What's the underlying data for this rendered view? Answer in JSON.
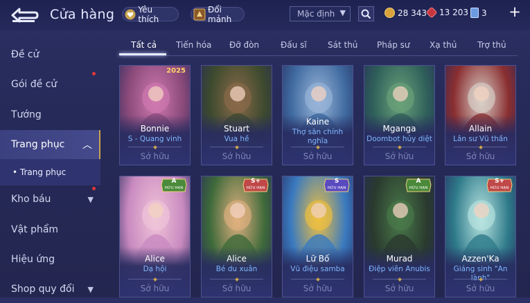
{
  "header": {
    "title": "Cửa hàng",
    "favorites_label": "Yêu thích",
    "exchange_label": "Đổi mảnh",
    "sort_value": "Mặc định",
    "currencies": [
      {
        "icon": "gold-coin-icon",
        "value": "28 343",
        "color": "#d9a23a"
      },
      {
        "icon": "red-gem-icon",
        "value": "13 203",
        "color": "#d94a52"
      },
      {
        "icon": "voucher-icon",
        "value": "3",
        "color": "#9fc4ff"
      }
    ]
  },
  "sidebar": {
    "items": [
      {
        "label": "Đề cử"
      },
      {
        "label": "Gói đề cử"
      },
      {
        "label": "Tướng"
      },
      {
        "label": "Trang phục"
      },
      {
        "label": "• Trang phục"
      },
      {
        "label": "Kho báu"
      },
      {
        "label": "Vật phẩm"
      },
      {
        "label": "Hiệu ứng"
      },
      {
        "label": "Shop quy đổi"
      }
    ]
  },
  "tabs": [
    "Tất cả",
    "Tiến hóa",
    "Đỡ đòn",
    "Đấu sĩ",
    "Sát thủ",
    "Pháp sư",
    "Xạ thủ",
    "Trợ thủ"
  ],
  "cards": [
    {
      "name": "Bonnie",
      "skin": "S - Quang vinh",
      "status": "Sở hữu",
      "tag": "2025",
      "art": "#8a4a7a",
      "art2": "#d07ab0"
    },
    {
      "name": "Stuart",
      "skin": "Vua hề",
      "status": "Sở hữu",
      "art": "#3d4a2e",
      "art2": "#8a6a4a"
    },
    {
      "name": "Kaine",
      "skin": "Thợ săn chính nghĩa",
      "status": "Sở hữu",
      "art": "#3f6aa0",
      "art2": "#9ab6d8"
    },
    {
      "name": "Mganga",
      "skin": "Doombot hủy diệt",
      "status": "Sở hữu",
      "art": "#2f5f5a",
      "art2": "#6aa27a"
    },
    {
      "name": "Allain",
      "skin": "Lân sư Vũ thần",
      "status": "Sở hữu",
      "art": "#8a2e30",
      "art2": "#d8cfc8"
    },
    {
      "name": "Alice",
      "skin": "Dạ hội",
      "status": "Sở hữu",
      "badge": "A",
      "badge_sub": "HỮU HẠN",
      "art": "#c98ac0",
      "art2": "#f0c4d8"
    },
    {
      "name": "Alice",
      "skin": "Bé du xuân",
      "status": "Sở hữu",
      "badge": "S+",
      "badge_sub": "HỮU HẠN",
      "art": "#3e6a3a",
      "art2": "#e0b080"
    },
    {
      "name": "Lữ Bố",
      "skin": "Vũ điệu samba",
      "status": "Sở hữu",
      "badge": "S",
      "badge_sub": "HỮU HẠN",
      "art": "#3a7ac0",
      "art2": "#f0c040"
    },
    {
      "name": "Murad",
      "skin": "Điệp viên Anubis",
      "status": "Sở hữu",
      "badge": "A",
      "badge_sub": "HỮU HẠN",
      "art": "#2a3a2e",
      "art2": "#4a7a4a"
    },
    {
      "name": "Azzen'Ka",
      "skin": "Giáng sinh \"An lành\"",
      "status": "Sở hữu",
      "badge": "S+",
      "badge_sub": "HỮU HẠN",
      "art": "#2e7a8a",
      "art2": "#b8e4e0"
    }
  ]
}
